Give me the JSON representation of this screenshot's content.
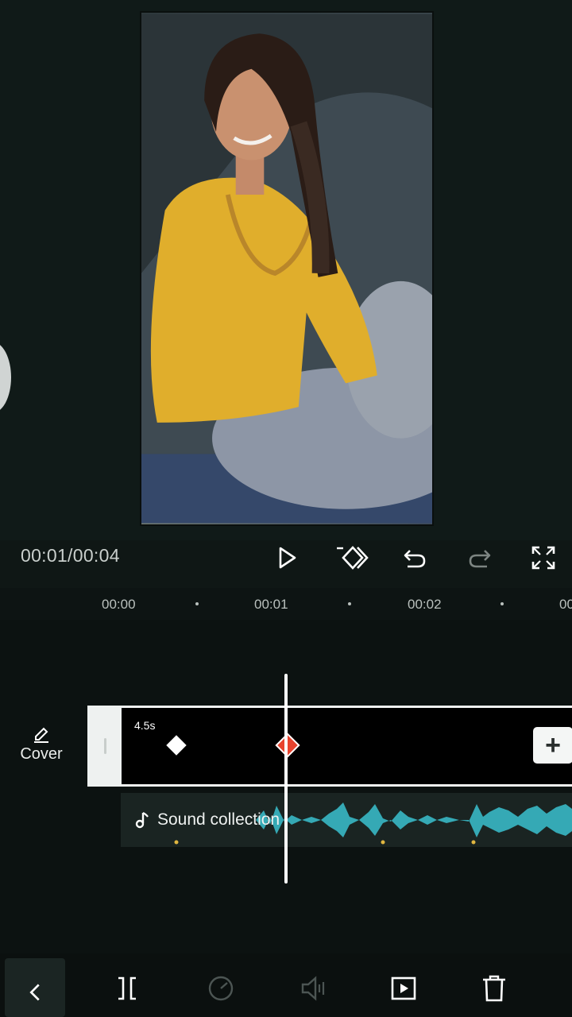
{
  "player": {
    "timecode": "00:01/00:04"
  },
  "ruler": {
    "labels": [
      "00:00",
      "00:01",
      "00:02",
      "00"
    ]
  },
  "cover": {
    "label": "Cover"
  },
  "clip": {
    "duration": "4.5s",
    "add_symbol": "+"
  },
  "audio": {
    "label": "Sound collection"
  },
  "colors": {
    "background": "#0f1715",
    "keyframe_active": "#e8432e",
    "waveform": "#35a9b5"
  },
  "icons": {
    "play": "play-icon",
    "keyframe": "keyframe-icon",
    "undo": "undo-icon",
    "redo": "redo-icon",
    "fullscreen": "fullscreen-icon",
    "cover": "pencil-icon",
    "music": "music-note-icon",
    "back": "chevron-left-icon",
    "split": "split-icon",
    "speed": "speed-icon",
    "volume": "volume-icon",
    "animation": "animation-icon",
    "delete": "trash-icon"
  }
}
